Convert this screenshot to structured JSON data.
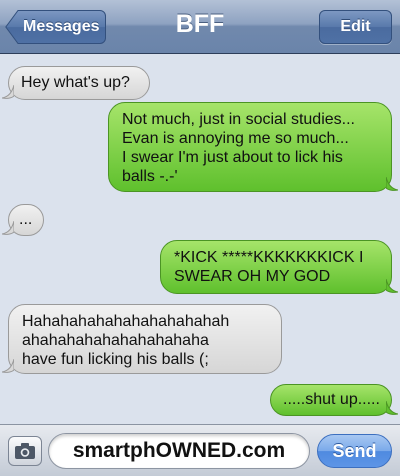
{
  "navbar": {
    "back_label": "Messages",
    "title": "BFF",
    "edit_label": "Edit"
  },
  "messages": [
    {
      "direction": "incoming",
      "text": "Hey what's up?"
    },
    {
      "direction": "outgoing",
      "text": "Not much, just in social studies...\nEvan is annoying me so much...\nI swear I'm just about to lick his\nballs -.-'"
    },
    {
      "direction": "incoming",
      "text": "..."
    },
    {
      "direction": "outgoing",
      "text": "*KICK *****KKKKKKKICK I\nSWEAR OH MY GOD"
    },
    {
      "direction": "incoming",
      "text": "Hahahahahahahahahahahah\nahahahahahahahahahaha\nhave fun licking his balls (;"
    },
    {
      "direction": "outgoing",
      "text": ".....shut up....."
    }
  ],
  "composer": {
    "camera_icon": "camera-icon",
    "input_value": "smartphOWNED.com",
    "send_label": "Send"
  },
  "colors": {
    "incoming_bubble": "#e4e4e4",
    "outgoing_bubble": "#7fd148",
    "background": "#dbe2ed",
    "navbar": "#7189ad"
  }
}
